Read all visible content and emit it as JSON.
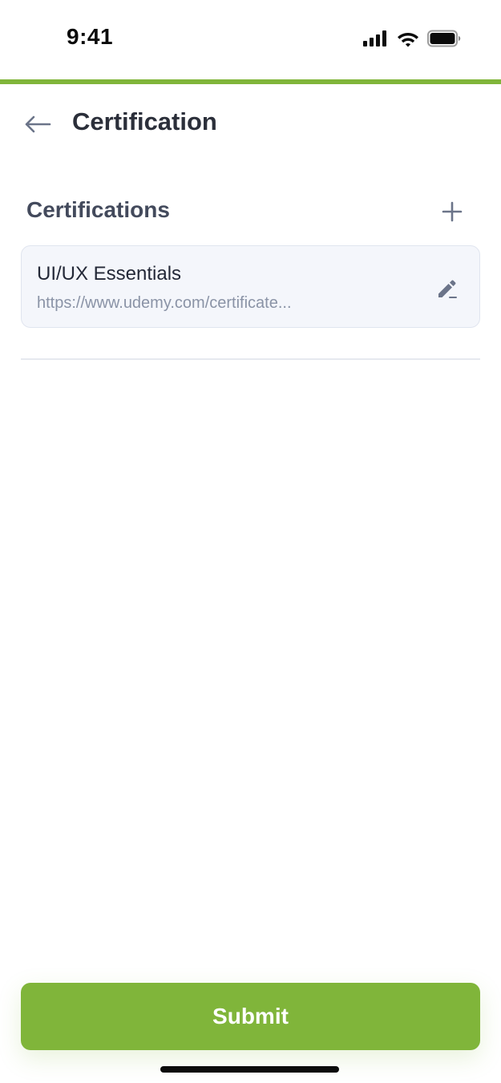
{
  "status_bar": {
    "time": "9:41",
    "icons": [
      "signal-icon",
      "wifi-icon",
      "battery-icon"
    ]
  },
  "colors": {
    "accent": "#80b53a",
    "title_text": "#2b2f3a",
    "secondary_text": "#8a93a6",
    "card_background": "#f4f6fb"
  },
  "header": {
    "back_icon": "arrow-left-icon",
    "title": "Certification"
  },
  "section": {
    "title": "Certifications",
    "add_icon": "plus-icon"
  },
  "certifications": [
    {
      "name": "UI/UX Essentials",
      "url": "https://www.udemy.com/certificate...",
      "edit_icon": "pencil-icon"
    }
  ],
  "footer": {
    "submit_label": "Submit"
  }
}
